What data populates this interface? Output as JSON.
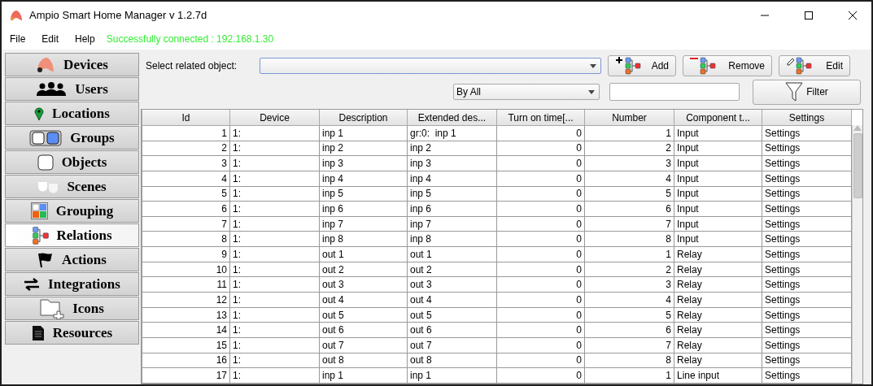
{
  "window": {
    "title": "Ampio Smart Home Manager v 1.2.7d"
  },
  "menu": [
    "File",
    "Edit",
    "Help"
  ],
  "status": "Successfully connected : 192.168.1.30",
  "sidebar": {
    "items": [
      {
        "label": "Devices",
        "selected": false
      },
      {
        "label": "Users",
        "selected": false
      },
      {
        "label": "Locations",
        "selected": false
      },
      {
        "label": "Groups",
        "selected": false
      },
      {
        "label": "Objects",
        "selected": false
      },
      {
        "label": "Scenes",
        "selected": false
      },
      {
        "label": "Grouping",
        "selected": false
      },
      {
        "label": "Relations",
        "selected": true
      },
      {
        "label": "Actions",
        "selected": false
      },
      {
        "label": "Integrations",
        "selected": false
      },
      {
        "label": "Icons",
        "selected": false
      },
      {
        "label": "Resources",
        "selected": false
      }
    ]
  },
  "toolbar": {
    "related_label": "Select related object:",
    "filter_mode": "By All",
    "buttons": [
      "Add",
      "Remove",
      "Edit"
    ],
    "filter_button": "Filter"
  },
  "table": {
    "columns": [
      "Id",
      "Device",
      "Description",
      "Extended des...",
      "Turn on time[...",
      "Number",
      "Component t...",
      "Settings"
    ],
    "rows": [
      [
        "1",
        "1:",
        "inp 1",
        "gr:0:  inp 1",
        "0",
        "1",
        "Input",
        "Settings"
      ],
      [
        "2",
        "1:",
        "inp 2",
        "inp 2",
        "0",
        "2",
        "Input",
        "Settings"
      ],
      [
        "3",
        "1:",
        "inp 3",
        "inp 3",
        "0",
        "3",
        "Input",
        "Settings"
      ],
      [
        "4",
        "1:",
        "inp 4",
        "inp 4",
        "0",
        "4",
        "Input",
        "Settings"
      ],
      [
        "5",
        "1:",
        "inp 5",
        "inp 5",
        "0",
        "5",
        "Input",
        "Settings"
      ],
      [
        "6",
        "1:",
        "inp 6",
        "inp 6",
        "0",
        "6",
        "Input",
        "Settings"
      ],
      [
        "7",
        "1:",
        "inp 7",
        "inp 7",
        "0",
        "7",
        "Input",
        "Settings"
      ],
      [
        "8",
        "1:",
        "inp 8",
        "inp 8",
        "0",
        "8",
        "Input",
        "Settings"
      ],
      [
        "9",
        "1:",
        "out 1",
        "out 1",
        "0",
        "1",
        "Relay",
        "Settings"
      ],
      [
        "10",
        "1:",
        "out 2",
        "out 2",
        "0",
        "2",
        "Relay",
        "Settings"
      ],
      [
        "11",
        "1:",
        "out 3",
        "out 3",
        "0",
        "3",
        "Relay",
        "Settings"
      ],
      [
        "12",
        "1:",
        "out 4",
        "out 4",
        "0",
        "4",
        "Relay",
        "Settings"
      ],
      [
        "13",
        "1:",
        "out 5",
        "out 5",
        "0",
        "5",
        "Relay",
        "Settings"
      ],
      [
        "14",
        "1:",
        "out 6",
        "out 6",
        "0",
        "6",
        "Relay",
        "Settings"
      ],
      [
        "15",
        "1:",
        "out 7",
        "out 7",
        "0",
        "7",
        "Relay",
        "Settings"
      ],
      [
        "16",
        "1:",
        "out 8",
        "out 8",
        "0",
        "8",
        "Relay",
        "Settings"
      ],
      [
        "17",
        "1:",
        "inp 1",
        "inp 1",
        "0",
        "1",
        "Line input",
        "Settings"
      ]
    ]
  }
}
